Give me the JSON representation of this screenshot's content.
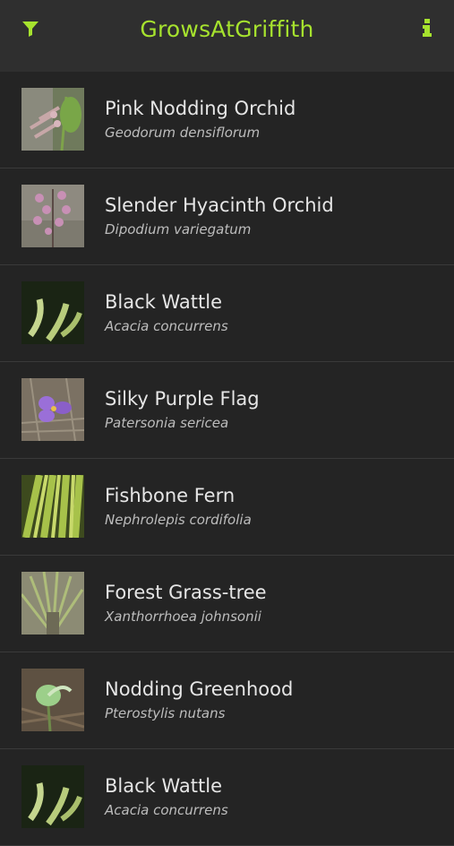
{
  "app": {
    "title": "GrowsAtGriffith",
    "accent": "#a6e22e",
    "filter_icon": "filter-icon",
    "info_icon": "info-icon"
  },
  "species": [
    {
      "common": "Pink Nodding Orchid",
      "scientific": "Geodorum densiflorum",
      "thumb": "pink-orchid"
    },
    {
      "common": "Slender Hyacinth Orchid",
      "scientific": "Dipodium variegatum",
      "thumb": "hyacinth-orchid"
    },
    {
      "common": "Black Wattle",
      "scientific": "Acacia concurrens",
      "thumb": "wattle"
    },
    {
      "common": "Silky Purple Flag",
      "scientific": "Patersonia sericea",
      "thumb": "purple-flag"
    },
    {
      "common": "Fishbone Fern",
      "scientific": "Nephrolepis cordifolia",
      "thumb": "fern"
    },
    {
      "common": "Forest Grass-tree",
      "scientific": "Xanthorrhoea johnsonii",
      "thumb": "grass-tree"
    },
    {
      "common": "Nodding Greenhood",
      "scientific": "Pterostylis nutans",
      "thumb": "greenhood"
    },
    {
      "common": "Black Wattle",
      "scientific": "Acacia concurrens",
      "thumb": "wattle"
    }
  ]
}
